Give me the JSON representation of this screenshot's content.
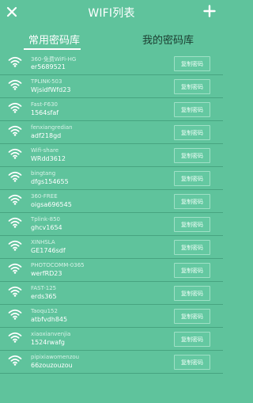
{
  "header": {
    "title": "WIFI列表",
    "back_icon": "close-icon",
    "add_icon": "plus-icon"
  },
  "tabs": [
    {
      "label": "常用密码库",
      "active": true
    },
    {
      "label": "我的密码库",
      "active": false
    }
  ],
  "copy_label": "复制密码",
  "rows": [
    {
      "ssid": "360-免费WiFi-HG",
      "password": "er5689521"
    },
    {
      "ssid": "TPLINK-503",
      "password": "WjsidfWfd23"
    },
    {
      "ssid": "Fast-F630",
      "password": "1564sfaf"
    },
    {
      "ssid": "fenxiangredian",
      "password": "adf218gd"
    },
    {
      "ssid": "Wifi-share",
      "password": "WRdd3612"
    },
    {
      "ssid": "bingtang",
      "password": "dfgs154655"
    },
    {
      "ssid": "360-FREE",
      "password": "oigsa696545"
    },
    {
      "ssid": "Tplink-850",
      "password": "ghcv1654"
    },
    {
      "ssid": "XINHSLA",
      "password": "GE1746sdf"
    },
    {
      "ssid": "PHOTOCOMM-0365",
      "password": "werfRD23"
    },
    {
      "ssid": "FAST-125",
      "password": "erds365"
    },
    {
      "ssid": "Taoqu152",
      "password": "atbfvdh845"
    },
    {
      "ssid": "xiaoxianvenjia",
      "password": "1524rwafg"
    },
    {
      "ssid": "pipixiawomenzou",
      "password": "66zouzouzou"
    }
  ],
  "colors": {
    "background": "#5fc39c",
    "inactive_tab": "#1a3c2f",
    "button_border": "#9fe0c6"
  }
}
